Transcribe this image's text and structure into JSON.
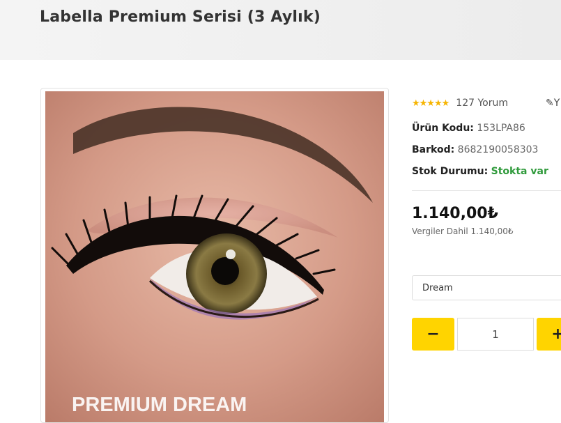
{
  "page": {
    "title": "Labella Premium Serisi (3 Aylık)"
  },
  "product": {
    "image_caption": "PREMIUM DREAM",
    "rating": {
      "stars": 5,
      "stars_text": "★★★★★",
      "review_count": "127 Yorum"
    },
    "edit_label": "✎Y",
    "code": {
      "label": "Ürün Kodu:",
      "value": "153LPA86"
    },
    "barcode": {
      "label": "Barkod:",
      "value": "8682190058303"
    },
    "stock": {
      "label": "Stok Durumu:",
      "value": "Stokta var"
    },
    "price": "1.140,00₺",
    "tax_note": "Vergiler Dahil 1.140,00₺",
    "variant": {
      "selected": "Dream"
    },
    "quantity": {
      "value": "1",
      "minus": "−",
      "plus": "+"
    }
  },
  "colors": {
    "accent": "#ffd400",
    "star": "#f6b400",
    "in_stock": "#2f9a3b"
  }
}
